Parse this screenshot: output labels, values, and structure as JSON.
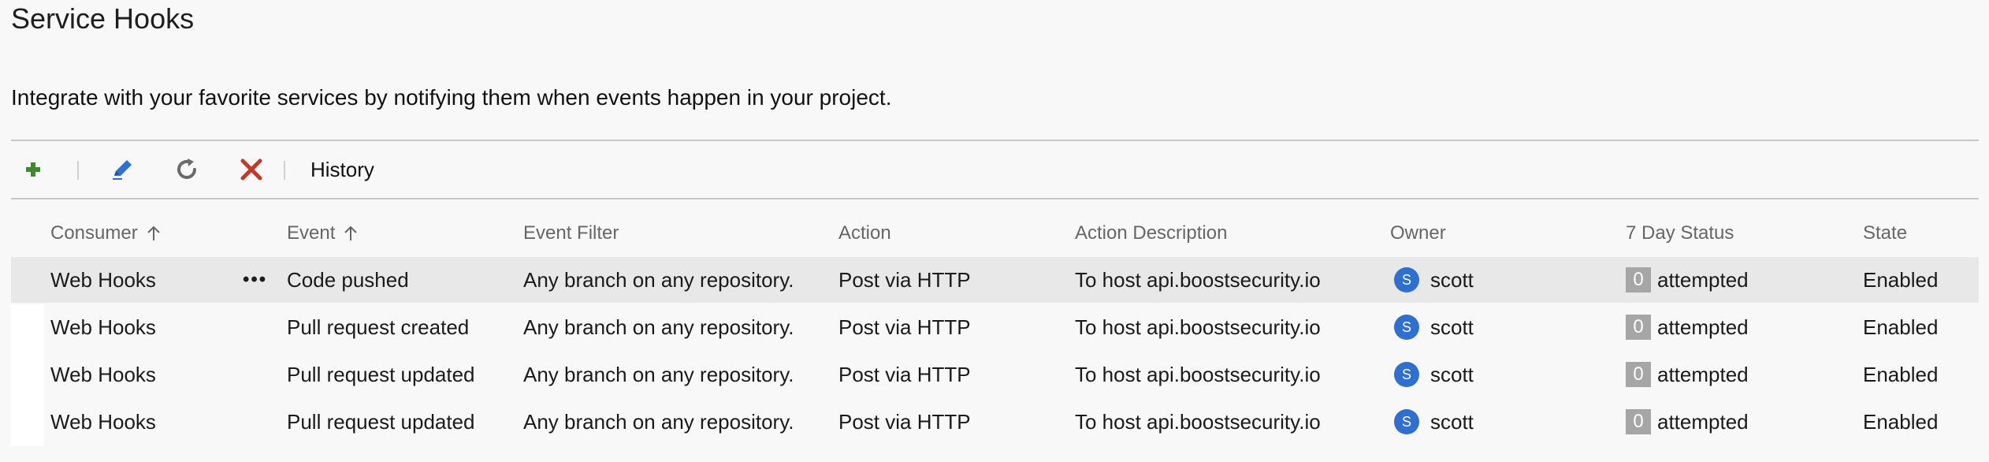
{
  "page": {
    "title": "Service Hooks",
    "description": "Integrate with your favorite services by notifying them when events happen in your project."
  },
  "toolbar": {
    "history_label": "History",
    "icons": [
      "plus-icon",
      "edit-icon",
      "refresh-icon",
      "delete-icon"
    ],
    "colors": {
      "add": "#3e8a2e",
      "edit": "#2f6fcf",
      "refresh": "#6a6a6a",
      "delete": "#c0392b"
    }
  },
  "table": {
    "columns": [
      "Consumer",
      "Event",
      "Event Filter",
      "Action",
      "Action Description",
      "Owner",
      "7 Day Status",
      "State"
    ],
    "sorted_columns": [
      "Consumer",
      "Event"
    ],
    "more_label": "•••",
    "rows": [
      {
        "consumer": "Web Hooks",
        "event": "Code pushed",
        "filter": "Any branch on any repository.",
        "action": "Post via HTTP",
        "description": "To host api.boostsecurity.io",
        "owner_initial": "S",
        "owner": "scott",
        "count": "0",
        "status": "attempted",
        "state": "Enabled"
      },
      {
        "consumer": "Web Hooks",
        "event": "Pull request created",
        "filter": "Any branch on any repository.",
        "action": "Post via HTTP",
        "description": "To host api.boostsecurity.io",
        "owner_initial": "S",
        "owner": "scott",
        "count": "0",
        "status": "attempted",
        "state": "Enabled"
      },
      {
        "consumer": "Web Hooks",
        "event": "Pull request updated",
        "filter": "Any branch on any repository.",
        "action": "Post via HTTP",
        "description": "To host api.boostsecurity.io",
        "owner_initial": "S",
        "owner": "scott",
        "count": "0",
        "status": "attempted",
        "state": "Enabled"
      },
      {
        "consumer": "Web Hooks",
        "event": "Pull request updated",
        "filter": "Any branch on any repository.",
        "action": "Post via HTTP",
        "description": "To host api.boostsecurity.io",
        "owner_initial": "S",
        "owner": "scott",
        "count": "0",
        "status": "attempted",
        "state": "Enabled"
      }
    ]
  }
}
